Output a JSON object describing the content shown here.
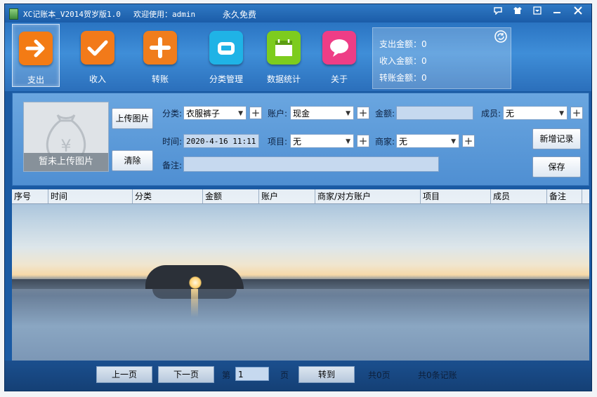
{
  "window": {
    "title": "XC记账本_V2014贺岁版1.0",
    "welcome": "欢迎使用：admin",
    "license": "永久免费"
  },
  "toolbar": {
    "items": [
      {
        "label": "支出",
        "color": "#f37b14",
        "icon": "arrow-right-icon"
      },
      {
        "label": "收入",
        "color": "#f27a1a",
        "icon": "checkmark-icon"
      },
      {
        "label": "转账",
        "color": "#f07d1c",
        "icon": "plus-icon"
      },
      {
        "label": "分类管理",
        "color": "#1fb3e6",
        "icon": "telephone-icon"
      },
      {
        "label": "数据统计",
        "color": "#7dcc1e",
        "icon": "calendar-icon"
      },
      {
        "label": "关于",
        "color": "#ee3d86",
        "icon": "speech-bubble-icon"
      }
    ]
  },
  "summary": {
    "expense": "支出金额：0",
    "income": "收入金额：0",
    "transfer": "转账金额：0"
  },
  "form": {
    "photo_caption": "暂未上传图片",
    "upload_label": "上传图片",
    "clear_label": "清除",
    "category_label": "分类:",
    "category_value": "衣服裤子",
    "account_label": "账户:",
    "account_value": "现金",
    "amount_label": "金额:",
    "amount_value": "",
    "member_label": "成员:",
    "member_value": "无",
    "time_label": "时间:",
    "time_value": "2020-4-16 11:11",
    "project_label": "项目:",
    "project_value": "无",
    "merchant_label": "商家:",
    "merchant_value": "无",
    "note_label": "备注:",
    "note_value": "",
    "add_label": "新增记录",
    "save_label": "保存"
  },
  "table": {
    "columns": [
      "序号",
      "时间",
      "分类",
      "金额",
      "账户",
      "商家/对方账户",
      "项目",
      "成员",
      "备注"
    ]
  },
  "pager": {
    "prev_label": "上一页",
    "next_label": "下一页",
    "page_prefix": "第",
    "page_value": "1",
    "page_suffix": "页",
    "goto_label": "转到",
    "total_pages": "共0页",
    "total_records": "共0条记账"
  }
}
